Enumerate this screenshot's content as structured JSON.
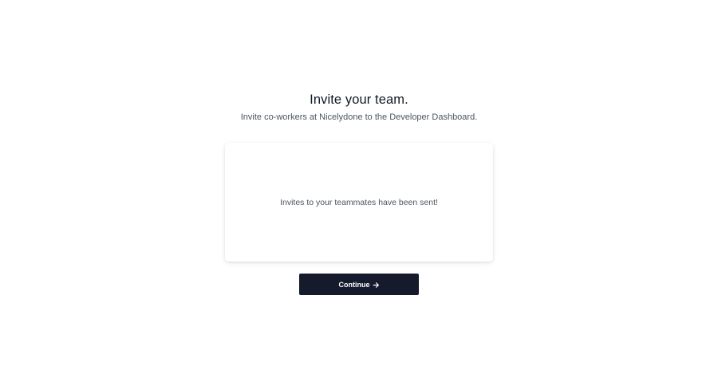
{
  "header": {
    "title": "Invite your team.",
    "subtitle": "Invite co-workers at Nicelydone to the Developer Dashboard."
  },
  "card": {
    "message": "Invites to your teammates have been sent!"
  },
  "actions": {
    "continue_label": "Continue",
    "continue_icon": "arrow-right-icon"
  },
  "colors": {
    "background": "#ffffff",
    "button": "#151b2c",
    "title": "#111827",
    "muted_text": "#4b5563"
  }
}
